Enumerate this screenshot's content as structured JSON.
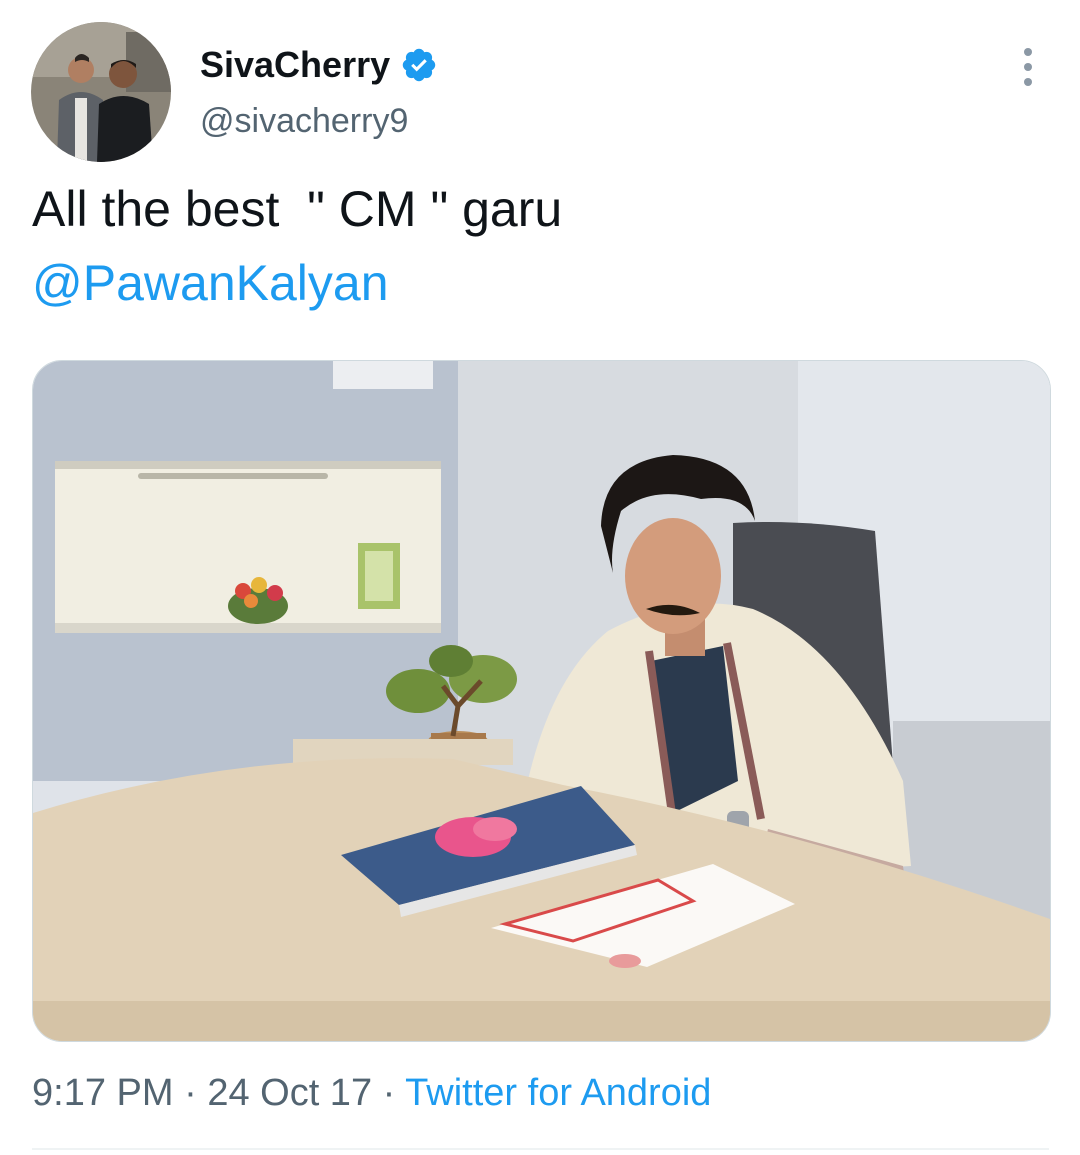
{
  "tweet": {
    "author": {
      "display_name": "SivaCherry",
      "handle": "@sivacherry9",
      "verified": true
    },
    "text_main": "All the best  \" CM \" garu",
    "mention": "@PawanKalyan",
    "meta": {
      "time": "9:17 PM",
      "separator": " · ",
      "date": "24 Oct 17",
      "source": "Twitter for Android"
    }
  },
  "icons": {
    "verified": "verified-badge-icon",
    "more": "more-options-icon"
  },
  "colors": {
    "link": "#1d9bf0",
    "secondary_text": "#536471",
    "primary_text": "#0f1419"
  }
}
